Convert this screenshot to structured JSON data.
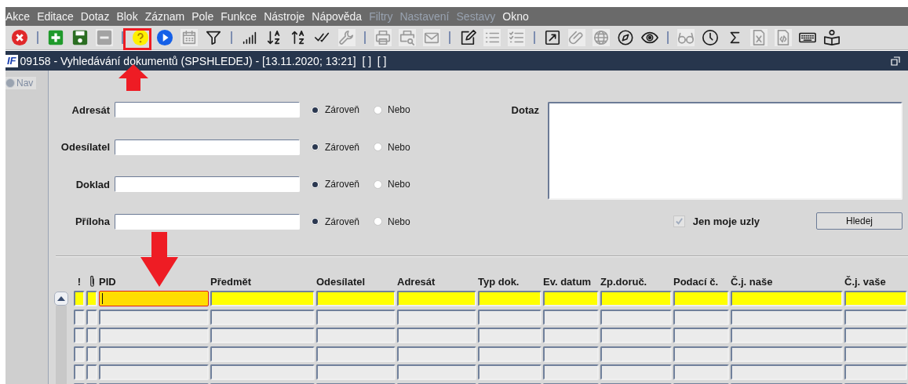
{
  "menu": [
    {
      "label": "Akce",
      "disabled": false
    },
    {
      "label": "Editace",
      "disabled": false
    },
    {
      "label": "Dotaz",
      "disabled": false
    },
    {
      "label": "Blok",
      "disabled": false
    },
    {
      "label": "Záznam",
      "disabled": false
    },
    {
      "label": "Pole",
      "disabled": false
    },
    {
      "label": "Funkce",
      "disabled": false
    },
    {
      "label": "Nástroje",
      "disabled": false
    },
    {
      "label": "Nápověda",
      "disabled": false
    },
    {
      "label": "Filtry",
      "disabled": true
    },
    {
      "label": "Nastavení",
      "disabled": true
    },
    {
      "label": "Sestavy",
      "disabled": true
    },
    {
      "label": "Okno",
      "disabled": false
    }
  ],
  "toolbar": [
    {
      "kind": "button",
      "disabled": false
    },
    {
      "kind": "separator"
    },
    {
      "kind": "button",
      "disabled": false
    },
    {
      "kind": "button",
      "disabled": false
    },
    {
      "kind": "button",
      "disabled": true
    },
    {
      "kind": "separator"
    },
    {
      "kind": "button",
      "disabled": false
    },
    {
      "kind": "button",
      "disabled": false
    },
    {
      "kind": "button",
      "disabled": true
    },
    {
      "kind": "button",
      "disabled": false
    },
    {
      "kind": "separator"
    },
    {
      "kind": "button",
      "disabled": false
    },
    {
      "kind": "button",
      "disabled": false
    },
    {
      "kind": "button",
      "disabled": false
    },
    {
      "kind": "button",
      "disabled": false
    },
    {
      "kind": "button",
      "disabled": true
    },
    {
      "kind": "separator"
    },
    {
      "kind": "button",
      "disabled": true
    },
    {
      "kind": "button",
      "disabled": true
    },
    {
      "kind": "button",
      "disabled": true
    },
    {
      "kind": "separator"
    },
    {
      "kind": "button",
      "disabled": false
    },
    {
      "kind": "button",
      "disabled": true
    },
    {
      "kind": "button",
      "disabled": true
    },
    {
      "kind": "separator"
    },
    {
      "kind": "button",
      "disabled": false
    },
    {
      "kind": "button",
      "disabled": true
    },
    {
      "kind": "button",
      "disabled": true
    },
    {
      "kind": "button",
      "disabled": false
    },
    {
      "kind": "button",
      "disabled": false
    },
    {
      "kind": "separator"
    },
    {
      "kind": "button",
      "disabled": true
    },
    {
      "kind": "button",
      "disabled": false
    },
    {
      "kind": "button",
      "disabled": false
    },
    {
      "kind": "button",
      "disabled": true
    },
    {
      "kind": "button",
      "disabled": true
    },
    {
      "kind": "button",
      "disabled": false
    },
    {
      "kind": "button",
      "disabled": false
    }
  ],
  "window": {
    "logo": "IF",
    "title": "09158 - Vyhledávání dokumentů (SPSHLEDEJ) - [13.11.2020; 13:21]  [ ]  [ ]"
  },
  "nav": {
    "label": "Nav"
  },
  "filters": [
    {
      "label": "Adresát",
      "options": [
        {
          "label": "Zároveň",
          "selected": true
        },
        {
          "label": "Nebo",
          "selected": false
        }
      ]
    },
    {
      "label": "Odesílatel",
      "options": [
        {
          "label": "Zároveň",
          "selected": true
        },
        {
          "label": "Nebo",
          "selected": false
        }
      ]
    },
    {
      "label": "Doklad",
      "options": [
        {
          "label": "Zároveň",
          "selected": true
        },
        {
          "label": "Nebo",
          "selected": false
        }
      ]
    },
    {
      "label": "Příloha",
      "options": [
        {
          "label": "Zároveň",
          "selected": true
        },
        {
          "label": "Nebo",
          "selected": false
        }
      ]
    }
  ],
  "query": {
    "label": "Dotaz"
  },
  "only_mine": {
    "label": "Jen moje uzly",
    "checked": true,
    "disabled": true
  },
  "search_button": "Hledej",
  "table": {
    "columns": [
      {
        "kind": "text",
        "label": "!",
        "focused": false
      },
      {
        "kind": "attachment",
        "focused": false
      },
      {
        "kind": "text",
        "label": "PID",
        "focused": true
      },
      {
        "kind": "text",
        "label": "Předmět",
        "focused": false
      },
      {
        "kind": "text",
        "label": "Odesílatel",
        "focused": false
      },
      {
        "kind": "text",
        "label": "Adresát",
        "focused": false
      },
      {
        "kind": "text",
        "label": "Typ dok.",
        "focused": false
      },
      {
        "kind": "text",
        "label": "Ev. datum",
        "focused": false
      },
      {
        "kind": "text",
        "label": "Zp.doruč.",
        "focused": false
      },
      {
        "kind": "text",
        "label": "Podací č.",
        "focused": false
      },
      {
        "kind": "text",
        "label": "Č.j. naše",
        "focused": false
      },
      {
        "kind": "text",
        "label": "Č.j. vaše",
        "focused": false
      }
    ],
    "rows": [
      {
        "selected": true
      },
      {
        "selected": false
      },
      {
        "selected": false
      },
      {
        "selected": false
      },
      {
        "selected": false
      },
      {
        "selected": false
      }
    ]
  }
}
